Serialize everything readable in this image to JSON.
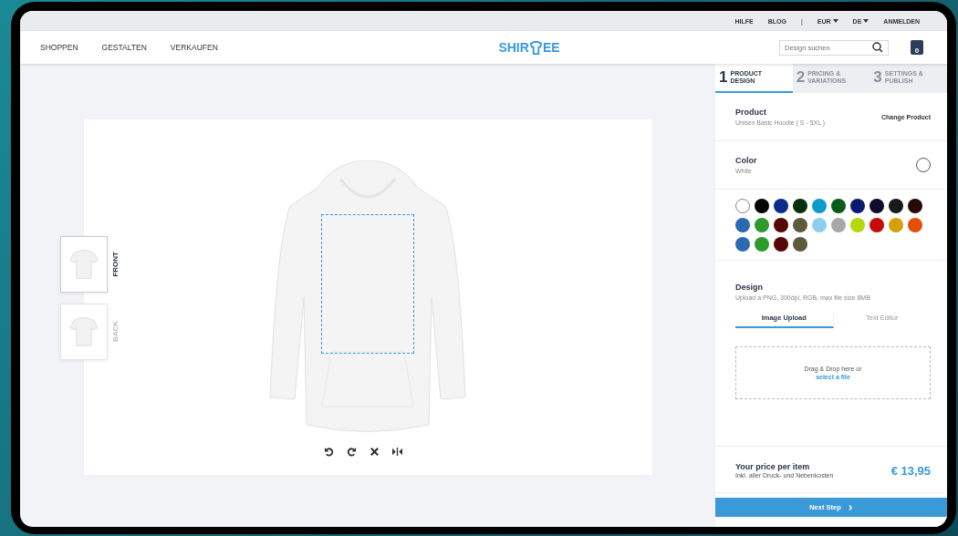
{
  "top_bar": {
    "links": [
      {
        "label": "HILFE",
        "kind": "link"
      },
      {
        "label": "BLOG",
        "kind": "link"
      },
      {
        "label": "|",
        "kind": "separator"
      },
      {
        "label": "EUR",
        "kind": "dropdown"
      },
      {
        "label": "DE",
        "kind": "dropdown"
      },
      {
        "label": "ANMELDEN",
        "kind": "link"
      }
    ]
  },
  "nav": {
    "items": [
      "SHOPPEN",
      "GESTALTEN",
      "VERKAUFEN"
    ],
    "logo": {
      "before": "SHIR",
      "after": "EE"
    },
    "search": {
      "placeholder": "Design suchen"
    },
    "cart_count": "0"
  },
  "views": [
    {
      "label": "FRONT",
      "selected": true
    },
    {
      "label": "BACK",
      "selected": false
    }
  ],
  "tools": [
    {
      "kind": "undo"
    },
    {
      "kind": "redo"
    },
    {
      "kind": "delete"
    },
    {
      "kind": "mirror"
    }
  ],
  "steps": [
    {
      "number": "1",
      "label": "PRODUCT DESIGN",
      "selected": true
    },
    {
      "number": "2",
      "label": "PRICING & VARIATIONS",
      "selected": false
    },
    {
      "number": "3",
      "label": "SETTINGS & PUBLISH",
      "selected": false
    }
  ],
  "product": {
    "title": "Product",
    "value": "Unisex Basic Hoodie ( S - 5XL )",
    "action": "Change Product"
  },
  "color": {
    "title": "Color",
    "value": "White"
  },
  "swatches": [
    {
      "color": "#ffffff",
      "selected": true
    },
    {
      "color": "#050505",
      "selected": false
    },
    {
      "color": "#0a2c8c",
      "selected": false
    },
    {
      "color": "#083010",
      "selected": false
    },
    {
      "color": "#0b9ccc",
      "selected": false
    },
    {
      "color": "#0a5a18",
      "selected": false
    },
    {
      "color": "#0b1a6e",
      "selected": false
    },
    {
      "color": "#120a2a",
      "selected": false
    },
    {
      "color": "#191919",
      "selected": false
    },
    {
      "color": "#250a06",
      "selected": false
    },
    {
      "color": "#2a6ab0",
      "selected": false
    },
    {
      "color": "#2c9a2c",
      "selected": false
    },
    {
      "color": "#560808",
      "selected": false
    },
    {
      "color": "#5e5a3c",
      "selected": false
    },
    {
      "color": "#8ecff0",
      "selected": false
    },
    {
      "color": "#a8a8a8",
      "selected": false
    },
    {
      "color": "#b4d80a",
      "selected": false
    },
    {
      "color": "#c80a0a",
      "selected": false
    },
    {
      "color": "#d4a00a",
      "selected": false
    },
    {
      "color": "#e05008",
      "selected": false
    },
    {
      "color": "#2a6ab2",
      "selected": false
    },
    {
      "color": "#2e9a2a",
      "selected": false
    },
    {
      "color": "#580606",
      "selected": false
    },
    {
      "color": "#5c5a3a",
      "selected": false
    }
  ],
  "design": {
    "title": "Design",
    "hint": "Upload a PNG, 300dpi, RGB, max file size 8MB",
    "tabs": [
      {
        "label": "Image Upload",
        "selected": true
      },
      {
        "label": "Text Editor",
        "selected": false
      }
    ],
    "drop_text": "Drag & Drop here or",
    "drop_link": "select a file"
  },
  "price": {
    "title": "Your price per item",
    "note": "Inkl. aller Druck- und Nebenkosten",
    "value": "€ 13,95"
  },
  "next_button": "Next Step"
}
